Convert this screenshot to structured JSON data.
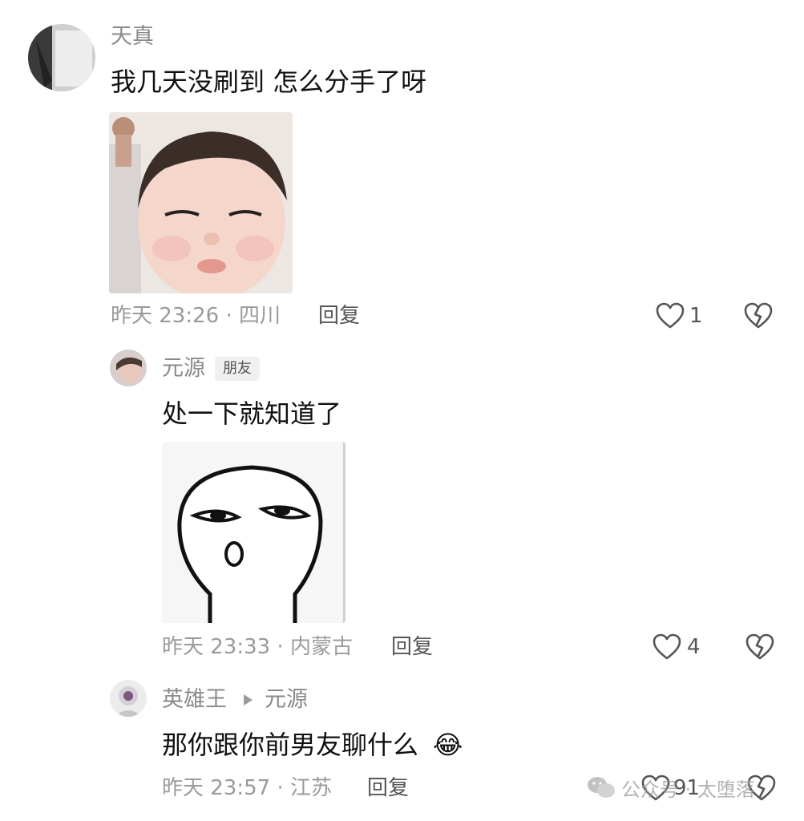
{
  "comments": [
    {
      "username": "天真",
      "text": "我几天没刷到 怎么分手了呀",
      "time_location": "昨天 23:26 · 四川",
      "reply_label": "回复",
      "likes": "1"
    },
    {
      "username": "元源",
      "tag": "朋友",
      "text": "处一下就知道了",
      "time_location": "昨天 23:33 · 内蒙古",
      "reply_label": "回复",
      "likes": "4"
    },
    {
      "username": "英雄王",
      "reply_to": "元源",
      "text": "那你跟你前男友聊什么",
      "emoji": "😂",
      "time_location": "昨天 23:57 · 江苏",
      "reply_label": "回复",
      "likes": "91"
    }
  ],
  "watermark": {
    "text": "公众号 · 太堕落"
  },
  "colors": {
    "secondary_text": "#9a9a9a",
    "primary_text": "#111111",
    "icon": "#555555"
  }
}
